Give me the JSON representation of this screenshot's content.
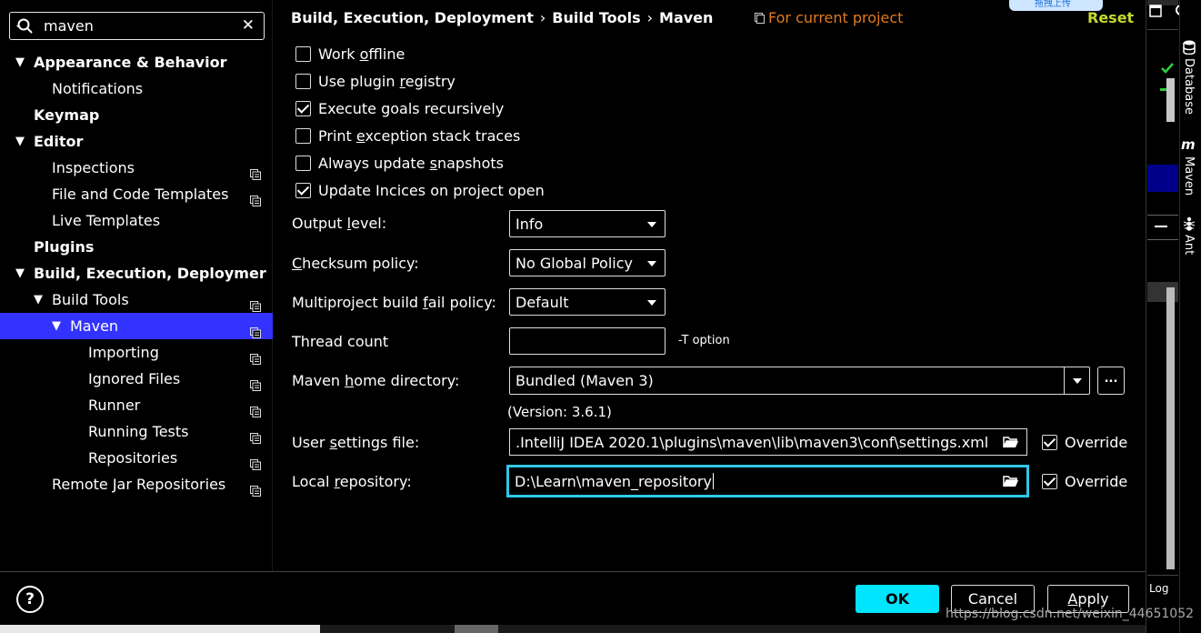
{
  "search": {
    "value": "maven"
  },
  "tree": [
    {
      "label": "Appearance & Behavior",
      "level": 0,
      "arrow": true,
      "bold": true,
      "badge": false,
      "selected": false
    },
    {
      "label": "Notifications",
      "level": 1,
      "arrow": false,
      "bold": false,
      "badge": false,
      "selected": false
    },
    {
      "label": "Keymap",
      "level": 0,
      "arrow": false,
      "bold": true,
      "badge": false,
      "selected": false
    },
    {
      "label": "Editor",
      "level": 0,
      "arrow": true,
      "bold": true,
      "badge": false,
      "selected": false
    },
    {
      "label": "Inspections",
      "level": 1,
      "arrow": false,
      "bold": false,
      "badge": true,
      "selected": false
    },
    {
      "label": "File and Code Templates",
      "level": 1,
      "arrow": false,
      "bold": false,
      "badge": true,
      "selected": false
    },
    {
      "label": "Live Templates",
      "level": 1,
      "arrow": false,
      "bold": false,
      "badge": false,
      "selected": false
    },
    {
      "label": "Plugins",
      "level": 0,
      "arrow": false,
      "bold": true,
      "badge": false,
      "selected": false
    },
    {
      "label": "Build, Execution, Deploymer",
      "level": 0,
      "arrow": true,
      "bold": true,
      "badge": false,
      "selected": false
    },
    {
      "label": "Build Tools",
      "level": 1,
      "arrow": true,
      "bold": false,
      "badge": true,
      "selected": false
    },
    {
      "label": "Maven",
      "level": 2,
      "arrow": true,
      "bold": false,
      "badge": true,
      "selected": true
    },
    {
      "label": "Importing",
      "level": 3,
      "arrow": false,
      "bold": false,
      "badge": true,
      "selected": false
    },
    {
      "label": "Ignored Files",
      "level": 3,
      "arrow": false,
      "bold": false,
      "badge": true,
      "selected": false
    },
    {
      "label": "Runner",
      "level": 3,
      "arrow": false,
      "bold": false,
      "badge": true,
      "selected": false
    },
    {
      "label": "Running Tests",
      "level": 3,
      "arrow": false,
      "bold": false,
      "badge": true,
      "selected": false
    },
    {
      "label": "Repositories",
      "level": 3,
      "arrow": false,
      "bold": false,
      "badge": true,
      "selected": false
    },
    {
      "label": "Remote Jar Repositories",
      "level": 1,
      "arrow": false,
      "bold": false,
      "badge": true,
      "selected": false
    }
  ],
  "header": {
    "crumb1": "Build, Execution, Deployment",
    "crumb2": "Build Tools",
    "crumb3": "Maven",
    "sep": "›",
    "scope": "For current project",
    "reset": "Reset"
  },
  "checkboxes": [
    {
      "pre": "Work ",
      "u": "o",
      "post": "ffline",
      "checked": false
    },
    {
      "pre": "Use plugin ",
      "u": "r",
      "post": "egistry",
      "checked": false
    },
    {
      "pre": "Execute goals recursively",
      "u": "",
      "post": "",
      "checked": true
    },
    {
      "pre": "Print ",
      "u": "e",
      "post": "xception stack traces",
      "checked": false
    },
    {
      "pre": "Always update ",
      "u": "s",
      "post": "napshots",
      "checked": false
    },
    {
      "pre": "Update Incices on project open",
      "u": "",
      "post": "",
      "checked": true
    }
  ],
  "form": {
    "output_level": {
      "pre": "Output ",
      "u": "l",
      "post": "evel:",
      "value": "Info"
    },
    "checksum": {
      "pre": "",
      "u": "C",
      "post": "hecksum policy:",
      "value": "No Global Policy"
    },
    "multiproject": {
      "pre": "Multiproject build ",
      "u": "f",
      "post": "ail policy:",
      "value": "Default"
    },
    "thread_count": {
      "label": "Thread count",
      "value": "",
      "hint": "-T option"
    },
    "maven_home": {
      "pre": "Maven ",
      "u": "h",
      "post": "ome directory:",
      "value": "Bundled (Maven 3)",
      "browse": "...",
      "version": "(Version: 3.6.1)"
    },
    "user_settings": {
      "pre": "User ",
      "u": "s",
      "post": "ettings file:",
      "value": ".IntelliJ IDEA 2020.1\\plugins\\maven\\lib\\maven3\\conf\\settings.xml",
      "override": "Override",
      "override_checked": true
    },
    "local_repo": {
      "pre": "Local ",
      "u": "r",
      "post": "epository:",
      "value": "D:\\Learn\\maven_repository",
      "override": "Override",
      "override_checked": true
    }
  },
  "buttons": {
    "help": "?",
    "ok": "OK",
    "cancel": "Cancel",
    "apply_u": "A",
    "apply_post": "pply"
  },
  "tool_windows": {
    "database": "Database",
    "maven": "Maven",
    "ant": "Ant",
    "log": "Log"
  },
  "upload_tag": "拖拽上传",
  "watermark": "https://blog.csdn.net/weixin_44651052",
  "colors": {
    "selected": "#3333ff",
    "ok": "#00e5ff",
    "focus": "#2ec8e6",
    "scope": "#e07a1f",
    "reset": "#c5d92c"
  }
}
